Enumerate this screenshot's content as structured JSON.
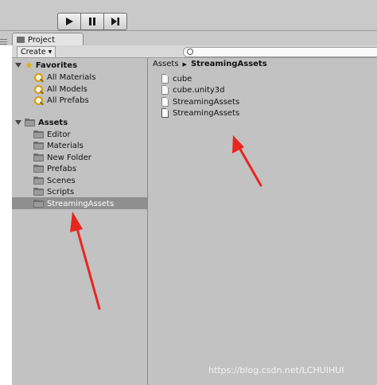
{
  "toolbar": {
    "play_icon": "play-icon",
    "pause_icon": "pause-icon",
    "step_icon": "step-icon"
  },
  "tab": {
    "label": "Project"
  },
  "panel_toolbar": {
    "create_label": "Create",
    "search_placeholder": ""
  },
  "tree": {
    "favorites": {
      "label": "Favorites",
      "items": [
        "All Materials",
        "All Models",
        "All Prefabs"
      ]
    },
    "assets": {
      "label": "Assets",
      "folders": [
        "Editor",
        "Materials",
        "New Folder",
        "Prefabs",
        "Scenes",
        "Scripts",
        "StreamingAssets"
      ],
      "selected": "StreamingAssets"
    }
  },
  "breadcrumb": {
    "root": "Assets",
    "current": "StreamingAssets"
  },
  "files": [
    "cube",
    "cube.unity3d",
    "StreamingAssets",
    "StreamingAssets"
  ],
  "annotation_color": "#e8261e",
  "watermark": "https://blog.csdn.net/LCHUIHUI",
  "colors": {
    "panel_bg": "#c2c2c2",
    "selection_bg": "#8f8f8f"
  }
}
